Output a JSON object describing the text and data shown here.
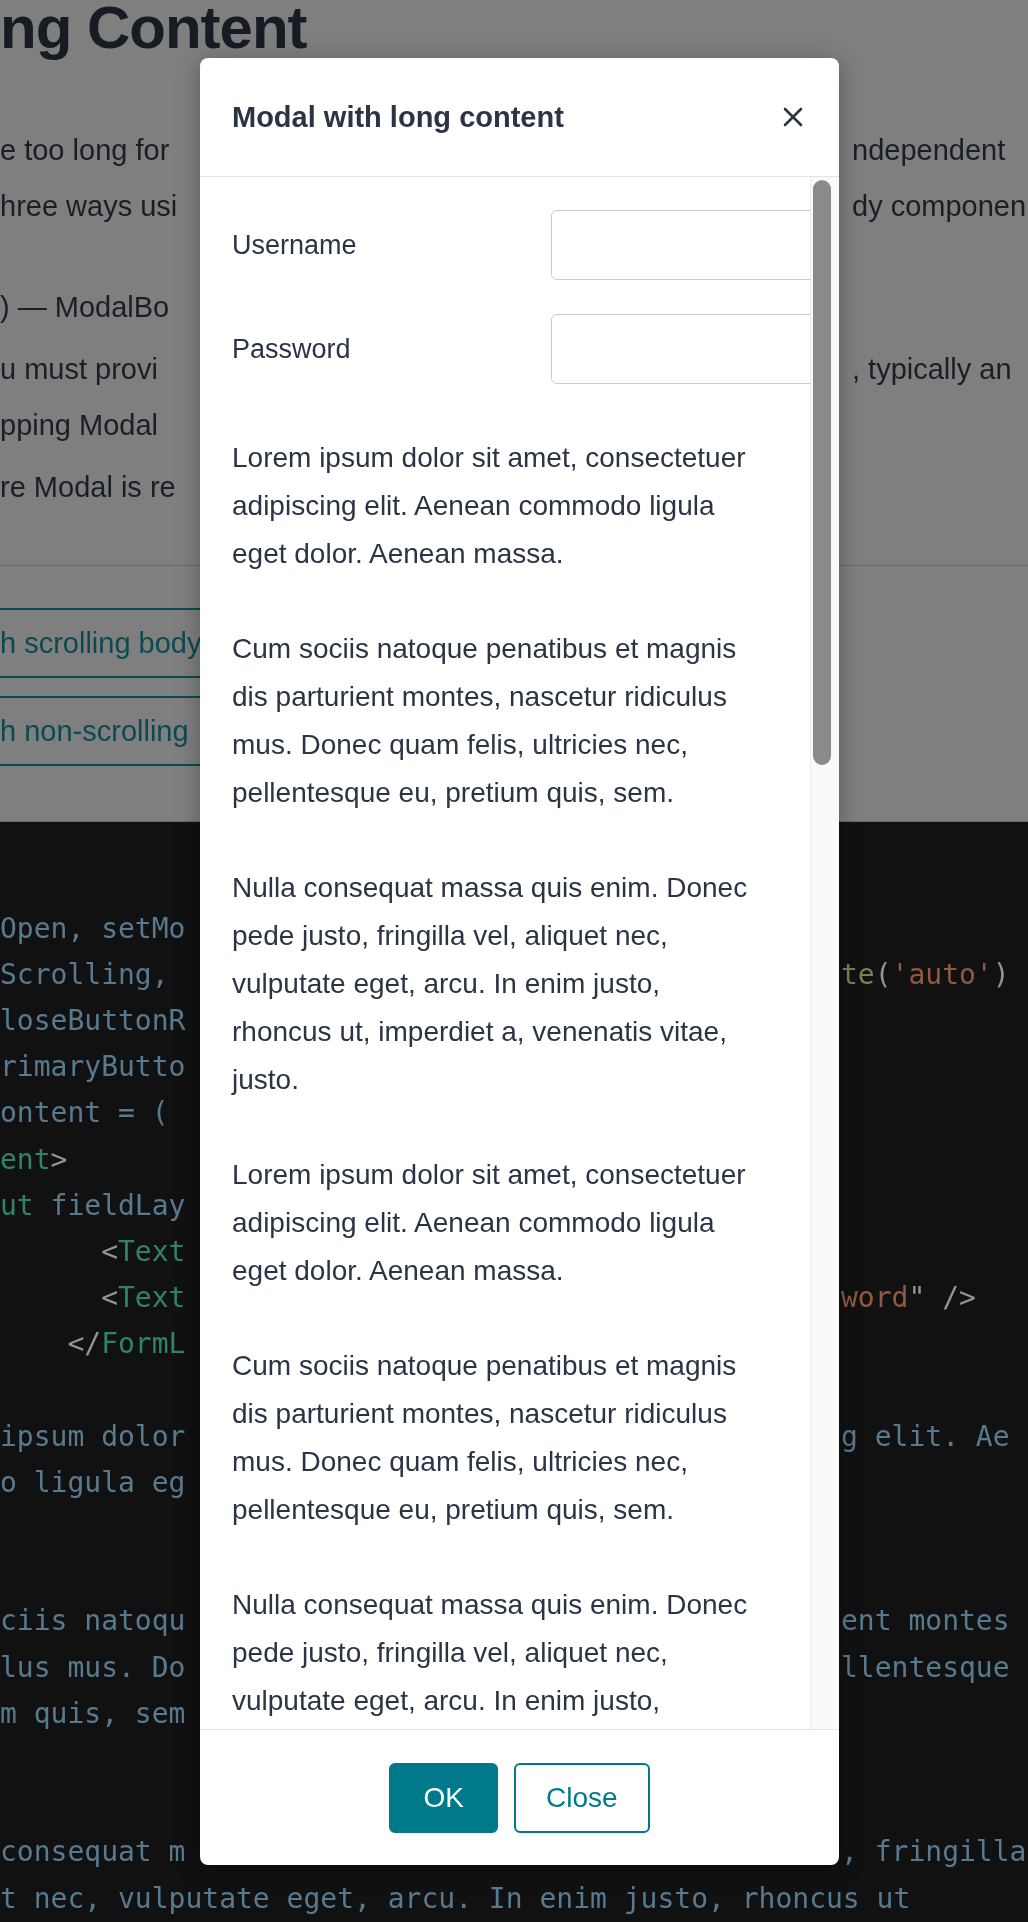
{
  "background": {
    "heading": "ng Content",
    "paragraphs": [
      {
        "lines": [
          {
            "left": "e too long for",
            "right": "ndependent"
          },
          {
            "left": "hree ways usi",
            "right": "dy componen"
          }
        ]
      },
      {
        "lines": [
          {
            "left": ") — ModalBo"
          }
        ]
      },
      {
        "lines": [
          {
            "left": "u must provi",
            "right": ", typically an"
          },
          {
            "left": "pping Modal"
          }
        ]
      },
      {
        "lines": [
          {
            "left": "re Modal is re"
          }
        ]
      }
    ],
    "buttons": [
      "h scrolling body",
      "h non-scrolling"
    ]
  },
  "code": {
    "lines": [
      {
        "kind": "split",
        "left": [
          {
            "kind": "id",
            "text": "Open, setMo"
          }
        ]
      },
      {
        "kind": "split",
        "left": [
          {
            "kind": "id",
            "text": "Scrolling,"
          }
        ],
        "right": [
          {
            "kind": "fn",
            "text": "te"
          },
          {
            "kind": "punct",
            "text": "("
          },
          {
            "kind": "str",
            "text": "'auto'"
          },
          {
            "kind": "punct",
            "text": ")"
          }
        ]
      },
      {
        "kind": "split",
        "left": [
          {
            "kind": "id",
            "text": "loseButtonR"
          }
        ]
      },
      {
        "kind": "split",
        "left": [
          {
            "kind": "id",
            "text": "rimaryButto"
          }
        ]
      },
      {
        "kind": "split",
        "left": [
          {
            "kind": "id",
            "text": "ontent = ("
          }
        ]
      },
      {
        "kind": "split",
        "left": [
          {
            "kind": "tag",
            "text": "ent"
          },
          {
            "kind": "punct",
            "text": ">"
          }
        ]
      },
      {
        "kind": "split",
        "left": [
          {
            "kind": "tag",
            "text": "ut"
          },
          {
            "kind": "id",
            "text": " fieldLay"
          }
        ]
      },
      {
        "kind": "split",
        "left": [
          {
            "kind": "punct",
            "text": "      <"
          },
          {
            "kind": "tag",
            "text": "Text"
          }
        ]
      },
      {
        "kind": "split",
        "left": [
          {
            "kind": "punct",
            "text": "      <"
          },
          {
            "kind": "tag",
            "text": "Text"
          }
        ],
        "right": [
          {
            "kind": "str",
            "text": "word"
          },
          {
            "kind": "punct",
            "text": "\" />"
          }
        ]
      },
      {
        "kind": "split",
        "left": [
          {
            "kind": "punct",
            "text": "    </"
          },
          {
            "kind": "tag",
            "text": "FormL"
          }
        ]
      },
      {
        "kind": "blank"
      },
      {
        "kind": "split",
        "left": [
          {
            "kind": "id",
            "text": "ipsum dolor"
          }
        ],
        "right": [
          {
            "kind": "id",
            "text": "g elit. Ae"
          }
        ]
      },
      {
        "kind": "split",
        "left": [
          {
            "kind": "id",
            "text": "o ligula eg"
          }
        ]
      },
      {
        "kind": "blank"
      },
      {
        "kind": "blank"
      },
      {
        "kind": "split",
        "left": [
          {
            "kind": "id",
            "text": "ciis natoqu"
          }
        ],
        "right": [
          {
            "kind": "id",
            "text": "ent montes"
          }
        ]
      },
      {
        "kind": "split",
        "left": [
          {
            "kind": "id",
            "text": "lus mus. Do"
          }
        ],
        "right": [
          {
            "kind": "id",
            "text": "llentesque"
          }
        ]
      },
      {
        "kind": "split",
        "left": [
          {
            "kind": "id",
            "text": "m quis, sem"
          }
        ]
      },
      {
        "kind": "blank"
      },
      {
        "kind": "blank"
      },
      {
        "kind": "split",
        "left": [
          {
            "kind": "id",
            "text": "consequat m"
          }
        ],
        "right": [
          {
            "kind": "id",
            "text": ", fringilla"
          }
        ]
      },
      {
        "kind": "full",
        "left": [
          {
            "kind": "id",
            "text": "t nec, vulputate eget, arcu. In enim justo, rhoncus ut"
          }
        ]
      }
    ]
  },
  "modal": {
    "title": "Modal with long content",
    "fields": [
      {
        "label": "Username"
      },
      {
        "label": "Password"
      }
    ],
    "paragraphs": [
      "Lorem ipsum dolor sit amet, consectetuer adipiscing elit. Aenean commodo ligula eget dolor. Aenean massa.",
      "Cum sociis natoque penatibus et magnis dis parturient montes, nascetur ridiculus mus. Donec quam felis, ultricies nec, pellentesque eu, pretium quis, sem.",
      "Nulla consequat massa quis enim. Donec pede justo, fringilla vel, aliquet nec, vulputate eget, arcu. In enim justo, rhoncus ut, imperdiet a, venenatis vitae, justo.",
      "Lorem ipsum dolor sit amet, consectetuer adipiscing elit. Aenean commodo ligula eget dolor. Aenean massa.",
      "Cum sociis natoque penatibus et magnis dis parturient montes, nascetur ridiculus mus. Donec quam felis, ultricies nec, pellentesque eu, pretium quis, sem.",
      "Nulla consequat massa quis enim. Donec pede justo, fringilla vel, aliquet nec, vulputate eget, arcu. In enim justo,"
    ],
    "buttons": [
      {
        "label": "OK",
        "kind": "primary"
      },
      {
        "label": "Close",
        "kind": "secondary"
      }
    ]
  }
}
